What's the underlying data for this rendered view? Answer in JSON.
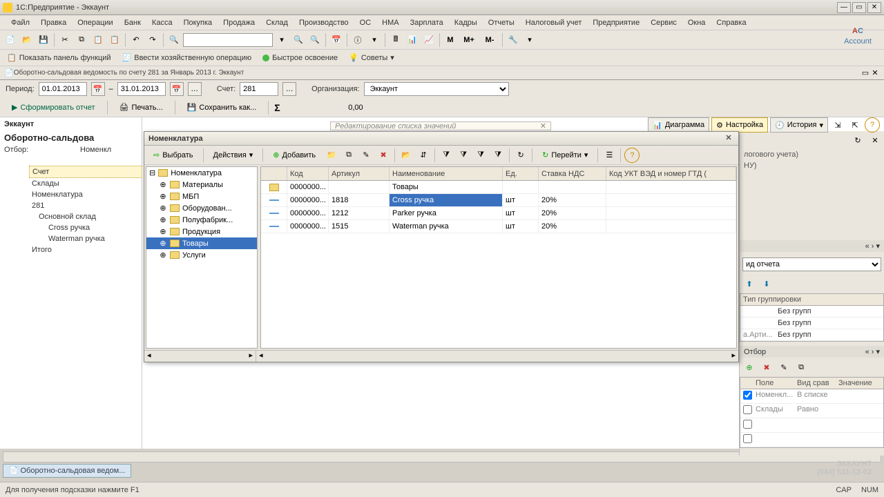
{
  "window": {
    "title": "1С:Предприятие - Эккаунт"
  },
  "menu": [
    "Файл",
    "Правка",
    "Операции",
    "Банк",
    "Касса",
    "Покупка",
    "Продажа",
    "Склад",
    "Производство",
    "ОС",
    "НМА",
    "Зарплата",
    "Кадры",
    "Отчеты",
    "Налоговый учет",
    "Предприятие",
    "Сервис",
    "Окна",
    "Справка"
  ],
  "toolbar1": {
    "m": "М",
    "m_plus": "М+",
    "m_minus": "М-"
  },
  "toolbar2": {
    "show_panel": "Показать панель функций",
    "enter_op": "Ввести хозяйственную операцию",
    "quick": "Быстрое освоение",
    "tips": "Советы"
  },
  "doc_tab": "Оборотно-сальдовая ведомость по счету 281 за Январь 2013 г. Эккаунт",
  "filter": {
    "period_label": "Период:",
    "from": "01.01.2013",
    "to": "31.01.2013",
    "account_label": "Счет:",
    "account": "281",
    "org_label": "Организация:",
    "org": "Эккаунт"
  },
  "actions": {
    "form": "Сформировать отчет",
    "print": "Печать...",
    "save_as": "Сохранить как...",
    "amount": "0,00",
    "diagram": "Диаграмма",
    "settings": "Настройка",
    "history": "История"
  },
  "left": {
    "org": "Эккаунт",
    "title": "Оборотно-сальдова",
    "filter_label": "Отбор:",
    "filter_col": "Номенкл",
    "rows": [
      "Счет",
      "Склады",
      "Номенклатура",
      "281"
    ],
    "warehouse": "Основной склад",
    "items": [
      "Cross ручка",
      "Waterman ручка"
    ],
    "total": "Итого"
  },
  "popup_title": "Редактирование списка значений",
  "nom": {
    "title": "Номенклатура",
    "select": "Выбрать",
    "actions": "Действия",
    "add": "Добавить",
    "go": "Перейти",
    "tree_root": "Номенклатура",
    "tree": [
      "Материалы",
      "МБП",
      "Оборудован...",
      "Полуфабрик...",
      "Продукция",
      "Товары",
      "Услуги"
    ],
    "selected_tree": "Товары",
    "cols": {
      "code": "Код",
      "art": "Артикул",
      "name": "Наименование",
      "unit": "Ед.",
      "vat": "Ставка НДС",
      "ukt": "Код УКТ ВЭД и номер ГТД ("
    },
    "rows": [
      {
        "code": "0000000...",
        "art": "",
        "name": "Товары",
        "unit": "",
        "vat": "",
        "folder": true
      },
      {
        "code": "0000000...",
        "art": "1818",
        "name": "Cross ручка",
        "unit": "шт",
        "vat": "20%",
        "sel": true
      },
      {
        "code": "0000000...",
        "art": "1212",
        "name": "Parker ручка",
        "unit": "шт",
        "vat": "20%"
      },
      {
        "code": "0000000...",
        "art": "1515",
        "name": "Waterman ручка",
        "unit": "шт",
        "vat": "20%"
      }
    ]
  },
  "right": {
    "text1": "логового учета)",
    "text2": "НУ)",
    "report_type": "ид отчета",
    "group_hdr": "Тип группировки",
    "group_vals": [
      "Без групп",
      "Без групп",
      "Без групп"
    ],
    "field_arti": "а.Арти...",
    "filter_hdr": "Отбор",
    "cols": [
      "Поле",
      "Вид срав",
      "Значение"
    ],
    "rows": [
      {
        "f": "Номенкл...",
        "c": "В списке",
        "v": ""
      },
      {
        "f": "Склады",
        "c": "Равно",
        "v": ""
      }
    ]
  },
  "watermark": {
    "name": "ЭККАУНТ",
    "phone": "(044) 531-12-02"
  },
  "bottom_tab": "Оборотно-сальдовая ведом...",
  "status": {
    "hint": "Для получения подсказки нажмите F1",
    "cap": "CAP",
    "num": "NUM"
  },
  "logo": "Account"
}
